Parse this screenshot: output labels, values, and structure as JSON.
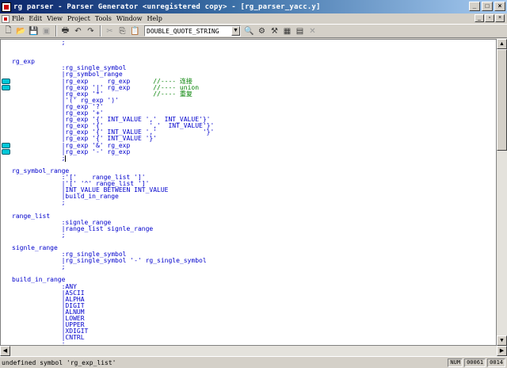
{
  "window": {
    "title": "rg parser - Parser Generator <unregistered copy> - [rg_parser_yacc.y]",
    "controls": [
      "_",
      "□",
      "×"
    ]
  },
  "menu": [
    "File",
    "Edit",
    "View",
    "Project",
    "Tools",
    "Window",
    "Help"
  ],
  "toolbar": {
    "combo_value": "DOUBLE_QUOTE_STRING"
  },
  "editor": {
    "lines": [
      {
        "text": "             ;"
      },
      {
        "text": ""
      },
      {
        "text": ""
      },
      {
        "text": "rg_exp"
      },
      {
        "text": "             :rg_single_symbol"
      },
      {
        "text": "             |rg_symbol_range"
      },
      {
        "text": "             |rg_exp     rg_exp      ",
        "comment": "//---- 连接",
        "marker": true
      },
      {
        "text": "             |rg_exp '|' rg_exp      ",
        "comment": "//---- union",
        "marker": true
      },
      {
        "text": "             |rg_exp '*'             ",
        "comment": "//---- 重复"
      },
      {
        "text": "             |'(' rg_exp ')'"
      },
      {
        "text": "             |rg_exp '?'"
      },
      {
        "text": "             |rg_exp '+'"
      },
      {
        "text": "             |rg_exp '{' INT_VALUE ','  INT_VALUE'}'"
      },
      {
        "text": "             |rg_exp '{'            ','  INT_VALUE'}'"
      },
      {
        "text": "             |rg_exp '{' INT_VALUE ','            '}'"
      },
      {
        "text": "             |rg_exp '{' INT_VALUE '}'"
      },
      {
        "text": "             |rg_exp '&' rg_exp",
        "marker": true
      },
      {
        "text": "             |rg_exp '-' rg_exp",
        "marker": true
      },
      {
        "text": "             ;",
        "caret": true
      },
      {
        "text": ""
      },
      {
        "text": "rg_symbol_range"
      },
      {
        "text": "             :'['    range_list ']'"
      },
      {
        "text": "             |'[' '^' range_list ']'"
      },
      {
        "text": "             |INT_VALUE BETWEEN INT_VALUE"
      },
      {
        "text": "             |build_in_range"
      },
      {
        "text": "             ;"
      },
      {
        "text": ""
      },
      {
        "text": "range_list"
      },
      {
        "text": "             :signle_range"
      },
      {
        "text": "             |range_list signle_range"
      },
      {
        "text": "             ;"
      },
      {
        "text": ""
      },
      {
        "text": "signle_range"
      },
      {
        "text": "             :rg_single_symbol"
      },
      {
        "text": "             |rg_single_symbol '-' rg_single_symbol"
      },
      {
        "text": "             ;"
      },
      {
        "text": ""
      },
      {
        "text": "build_in_range"
      },
      {
        "text": "             :ANY"
      },
      {
        "text": "             |ASCII"
      },
      {
        "text": "             |ALPHA"
      },
      {
        "text": "             |DIGIT"
      },
      {
        "text": "             |ALNUM"
      },
      {
        "text": "             |LOWER"
      },
      {
        "text": "             |UPPER"
      },
      {
        "text": "             |XDIGIT"
      },
      {
        "text": "             |CNTRL"
      },
      {
        "text": "             ;"
      }
    ]
  },
  "status": {
    "message": "undefined symbol 'rg_exp_list'",
    "num": "NUM",
    "line": "00061",
    "col": "0014"
  }
}
